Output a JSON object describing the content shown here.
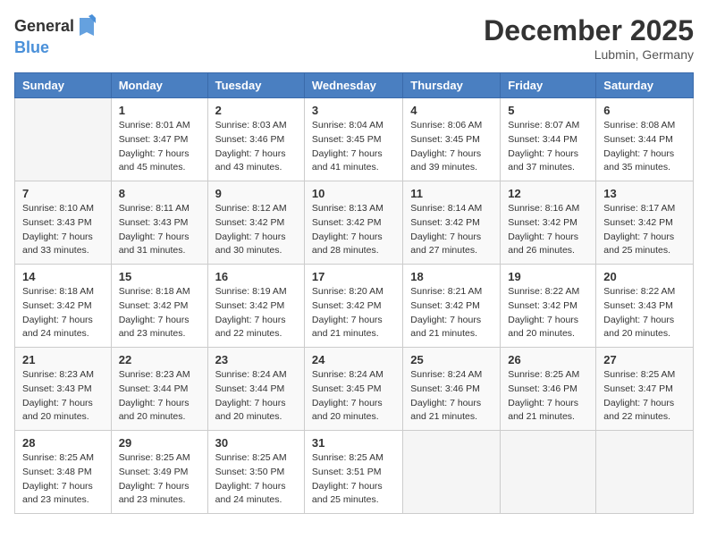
{
  "logo": {
    "general": "General",
    "blue": "Blue"
  },
  "title": "December 2025",
  "location": "Lubmin, Germany",
  "days_of_week": [
    "Sunday",
    "Monday",
    "Tuesday",
    "Wednesday",
    "Thursday",
    "Friday",
    "Saturday"
  ],
  "weeks": [
    [
      {
        "day": "",
        "info": ""
      },
      {
        "day": "1",
        "info": "Sunrise: 8:01 AM\nSunset: 3:47 PM\nDaylight: 7 hours\nand 45 minutes."
      },
      {
        "day": "2",
        "info": "Sunrise: 8:03 AM\nSunset: 3:46 PM\nDaylight: 7 hours\nand 43 minutes."
      },
      {
        "day": "3",
        "info": "Sunrise: 8:04 AM\nSunset: 3:45 PM\nDaylight: 7 hours\nand 41 minutes."
      },
      {
        "day": "4",
        "info": "Sunrise: 8:06 AM\nSunset: 3:45 PM\nDaylight: 7 hours\nand 39 minutes."
      },
      {
        "day": "5",
        "info": "Sunrise: 8:07 AM\nSunset: 3:44 PM\nDaylight: 7 hours\nand 37 minutes."
      },
      {
        "day": "6",
        "info": "Sunrise: 8:08 AM\nSunset: 3:44 PM\nDaylight: 7 hours\nand 35 minutes."
      }
    ],
    [
      {
        "day": "7",
        "info": "Sunrise: 8:10 AM\nSunset: 3:43 PM\nDaylight: 7 hours\nand 33 minutes."
      },
      {
        "day": "8",
        "info": "Sunrise: 8:11 AM\nSunset: 3:43 PM\nDaylight: 7 hours\nand 31 minutes."
      },
      {
        "day": "9",
        "info": "Sunrise: 8:12 AM\nSunset: 3:42 PM\nDaylight: 7 hours\nand 30 minutes."
      },
      {
        "day": "10",
        "info": "Sunrise: 8:13 AM\nSunset: 3:42 PM\nDaylight: 7 hours\nand 28 minutes."
      },
      {
        "day": "11",
        "info": "Sunrise: 8:14 AM\nSunset: 3:42 PM\nDaylight: 7 hours\nand 27 minutes."
      },
      {
        "day": "12",
        "info": "Sunrise: 8:16 AM\nSunset: 3:42 PM\nDaylight: 7 hours\nand 26 minutes."
      },
      {
        "day": "13",
        "info": "Sunrise: 8:17 AM\nSunset: 3:42 PM\nDaylight: 7 hours\nand 25 minutes."
      }
    ],
    [
      {
        "day": "14",
        "info": "Sunrise: 8:18 AM\nSunset: 3:42 PM\nDaylight: 7 hours\nand 24 minutes."
      },
      {
        "day": "15",
        "info": "Sunrise: 8:18 AM\nSunset: 3:42 PM\nDaylight: 7 hours\nand 23 minutes."
      },
      {
        "day": "16",
        "info": "Sunrise: 8:19 AM\nSunset: 3:42 PM\nDaylight: 7 hours\nand 22 minutes."
      },
      {
        "day": "17",
        "info": "Sunrise: 8:20 AM\nSunset: 3:42 PM\nDaylight: 7 hours\nand 21 minutes."
      },
      {
        "day": "18",
        "info": "Sunrise: 8:21 AM\nSunset: 3:42 PM\nDaylight: 7 hours\nand 21 minutes."
      },
      {
        "day": "19",
        "info": "Sunrise: 8:22 AM\nSunset: 3:42 PM\nDaylight: 7 hours\nand 20 minutes."
      },
      {
        "day": "20",
        "info": "Sunrise: 8:22 AM\nSunset: 3:43 PM\nDaylight: 7 hours\nand 20 minutes."
      }
    ],
    [
      {
        "day": "21",
        "info": "Sunrise: 8:23 AM\nSunset: 3:43 PM\nDaylight: 7 hours\nand 20 minutes."
      },
      {
        "day": "22",
        "info": "Sunrise: 8:23 AM\nSunset: 3:44 PM\nDaylight: 7 hours\nand 20 minutes."
      },
      {
        "day": "23",
        "info": "Sunrise: 8:24 AM\nSunset: 3:44 PM\nDaylight: 7 hours\nand 20 minutes."
      },
      {
        "day": "24",
        "info": "Sunrise: 8:24 AM\nSunset: 3:45 PM\nDaylight: 7 hours\nand 20 minutes."
      },
      {
        "day": "25",
        "info": "Sunrise: 8:24 AM\nSunset: 3:46 PM\nDaylight: 7 hours\nand 21 minutes."
      },
      {
        "day": "26",
        "info": "Sunrise: 8:25 AM\nSunset: 3:46 PM\nDaylight: 7 hours\nand 21 minutes."
      },
      {
        "day": "27",
        "info": "Sunrise: 8:25 AM\nSunset: 3:47 PM\nDaylight: 7 hours\nand 22 minutes."
      }
    ],
    [
      {
        "day": "28",
        "info": "Sunrise: 8:25 AM\nSunset: 3:48 PM\nDaylight: 7 hours\nand 23 minutes."
      },
      {
        "day": "29",
        "info": "Sunrise: 8:25 AM\nSunset: 3:49 PM\nDaylight: 7 hours\nand 23 minutes."
      },
      {
        "day": "30",
        "info": "Sunrise: 8:25 AM\nSunset: 3:50 PM\nDaylight: 7 hours\nand 24 minutes."
      },
      {
        "day": "31",
        "info": "Sunrise: 8:25 AM\nSunset: 3:51 PM\nDaylight: 7 hours\nand 25 minutes."
      },
      {
        "day": "",
        "info": ""
      },
      {
        "day": "",
        "info": ""
      },
      {
        "day": "",
        "info": ""
      }
    ]
  ]
}
